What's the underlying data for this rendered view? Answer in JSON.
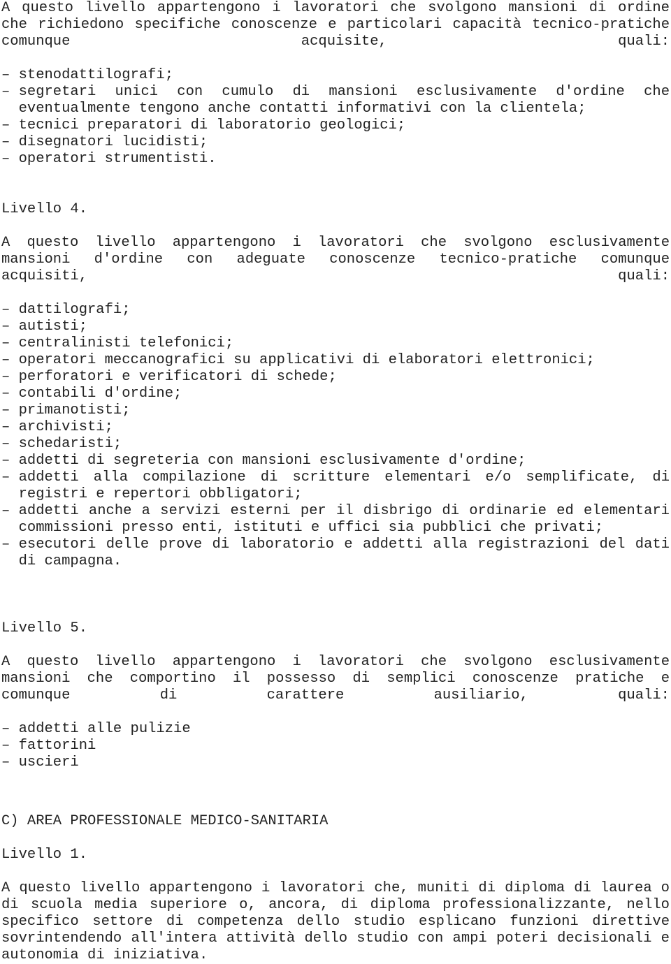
{
  "document": {
    "language": "it",
    "text_color": "#222222",
    "background_color": "#ffffff"
  },
  "sections": {
    "level3_continued": {
      "intro_paragraph": "A questo livello appartengono i lavoratori che svolgono mansioni di ordine che richiedono specifiche conoscenze e particolari capacità tecnico-pratiche comunque acquisite, quali:",
      "items": [
        "stenodattilografi;",
        "segretari unici con cumulo di mansioni esclusivamente d'ordine che eventualmente tengono anche contatti informativi con la clientela;",
        "tecnici preparatori di laboratorio geologici;",
        "disegnatori lucidisti;",
        "operatori strumentisti."
      ]
    },
    "level4": {
      "heading": "Livello 4.",
      "intro_paragraph": "A questo livello appartengono i lavoratori che svolgono esclusivamente mansioni d'ordine con adeguate conoscenze tecnico-pratiche comunque acquisiti, quali:",
      "items": [
        "dattilografi;",
        "autisti;",
        "centralinisti telefonici;",
        "operatori meccanografici su applicativi di elaboratori elettronici;",
        "perforatori e verificatori di schede;",
        "contabili d'ordine;",
        "primanotisti;",
        "archivisti;",
        "schedaristi;",
        "addetti di segreteria con mansioni esclusivamente d'ordine;",
        "addetti alla compilazione di scritture elementari e/o semplificate, di registri e repertori obbligatori;",
        "addetti anche a servizi esterni per il disbrigo di ordinarie ed elementari commissioni presso enti, istituti e uffici sia pubblici che privati;",
        "esecutori delle prove di laboratorio e addetti alla registrazioni del dati di campagna."
      ]
    },
    "level5": {
      "heading": "Livello 5.",
      "intro_paragraph": "A questo livello appartengono i lavoratori che svolgono esclusivamente mansioni che comportino il possesso di semplici conoscenze pratiche e comunque di carattere ausiliario, quali:",
      "items": [
        "addetti alle pulizie",
        "fattorini",
        "uscieri"
      ]
    },
    "area_c": {
      "heading": "C) AREA PROFESSIONALE MEDICO-SANITARIA",
      "level1": {
        "heading": "Livello 1.",
        "paragraph": "A questo livello appartengono i lavoratori che, muniti di diploma di laurea o di scuola media superiore o, ancora, di diploma professionalizzante, nello specifico settore di competenza dello studio esplicano funzioni direttive sovrintendendo all'intera attività dello studio con ampi poteri decisionali e autonomia di iniziativa."
      }
    }
  }
}
